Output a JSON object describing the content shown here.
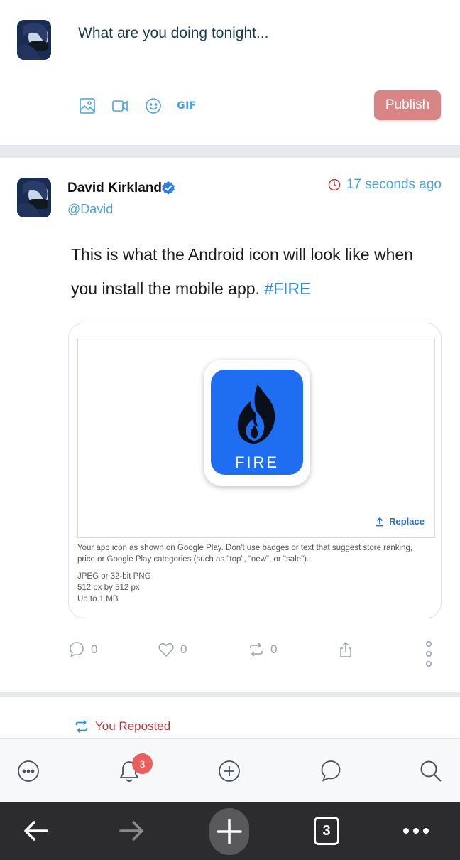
{
  "composer": {
    "placeholder": "What are you doing tonight...",
    "tools": [
      "image-icon",
      "video-icon",
      "emoji-icon",
      "gif-icon"
    ],
    "gif_label": "GIF",
    "publish_label": "Publish"
  },
  "post": {
    "author": "David Kirkland",
    "handle": "@David",
    "verified": true,
    "timestamp": "17 seconds ago",
    "text_before_hashtag": "This is what the Android icon will look like when you install the mobile app. ",
    "hashtag": "#FIRE",
    "attachment": {
      "app_icon_label": "FIRE",
      "replace_label": "Replace",
      "description": "Your app icon as shown on Google Play. Don't use badges or text that suggest store ranking, price or Google Play categories (such as \"top\", \"new\", or \"sale\").",
      "spec_format": "JPEG or 32-bit PNG",
      "spec_size": "512 px by 512 px",
      "spec_limit": "Up to 1 MB"
    },
    "actions": {
      "comments": "0",
      "likes": "0",
      "reposts": "0"
    }
  },
  "repost_notice": "You Reposted",
  "bottom_nav": {
    "items": [
      "more-icon",
      "notifications-icon",
      "add-icon",
      "messages-icon",
      "search-icon"
    ],
    "notification_count": "3"
  },
  "browser": {
    "tabs_count": "3"
  },
  "colors": {
    "accent": "#4aa3df",
    "publish": "#d98586",
    "app_icon_bg": "#1f6df0",
    "repost": "#b23b3b",
    "badge": "#e95e5e",
    "browser_bar": "#2c2c2e"
  }
}
